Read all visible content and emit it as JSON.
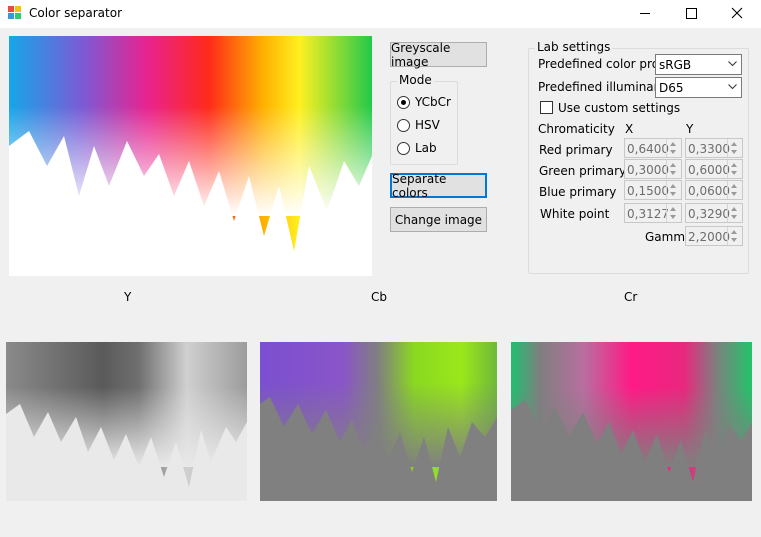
{
  "window": {
    "title": "Color separator"
  },
  "buttons": {
    "greyscale": "Greyscale image",
    "separate": "Separate colors",
    "change": "Change image"
  },
  "mode": {
    "title": "Mode",
    "options": [
      "YCbCr",
      "HSV",
      "Lab"
    ],
    "selected": "YCbCr"
  },
  "lab": {
    "title": "Lab settings",
    "profile_label": "Predefined color profile",
    "profile_value": "sRGB",
    "illuminant_label": "Predefined illuminant",
    "illuminant_value": "D65",
    "custom_label": "Use custom settings",
    "custom_checked": false,
    "chromaticity_label": "Chromaticity",
    "x_header": "X",
    "y_header": "Y",
    "rows": [
      {
        "label": "Red primary",
        "x": "0,6400",
        "y": "0,3300"
      },
      {
        "label": "Green primary",
        "x": "0,3000",
        "y": "0,6000"
      },
      {
        "label": "Blue primary",
        "x": "0,1500",
        "y": "0,0600"
      },
      {
        "label": "White point",
        "x": "0,3127",
        "y": "0,3290"
      }
    ],
    "gamma_label": "Gamma",
    "gamma_value": "2,2000"
  },
  "captions": {
    "y": "Y",
    "cb": "Cb",
    "cr": "Cr"
  },
  "colors": {
    "accent": "#0078d7",
    "window_bg": "#f0f0f0"
  }
}
